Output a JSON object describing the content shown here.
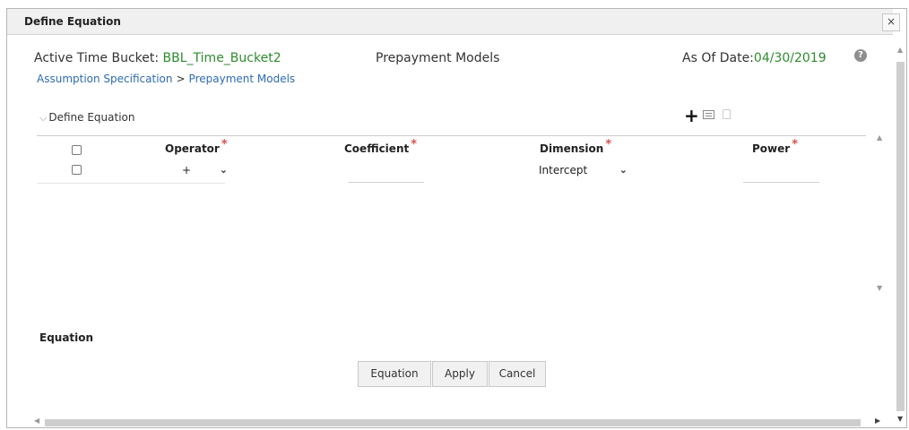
{
  "dialog": {
    "title": "Define Equation",
    "close_label": "×"
  },
  "header": {
    "active_time_bucket_label": "Active Time Bucket: ",
    "active_time_bucket_value": "BBL_Time_Bucket2",
    "page_title": "Prepayment Models",
    "as_of_label": "As Of Date:",
    "as_of_value": "04/30/2019",
    "help_icon": "?"
  },
  "breadcrumb": {
    "items": [
      "Assumption Specification",
      "Prepayment Models"
    ],
    "separator": ">"
  },
  "section": {
    "title": "Define Equation",
    "toggle_icon": "chevron-down-icon"
  },
  "toolbar": {
    "add_label": "+"
  },
  "table": {
    "columns": [
      "Operator",
      "Coefficient",
      "Dimension",
      "Power"
    ],
    "required_marker": "*",
    "rows": [
      {
        "operator": "+",
        "coefficient": "",
        "dimension": "Intercept",
        "power": ""
      }
    ]
  },
  "equation": {
    "label": "Equation"
  },
  "buttons": {
    "equation": "Equation",
    "apply": "Apply",
    "cancel": "Cancel"
  }
}
